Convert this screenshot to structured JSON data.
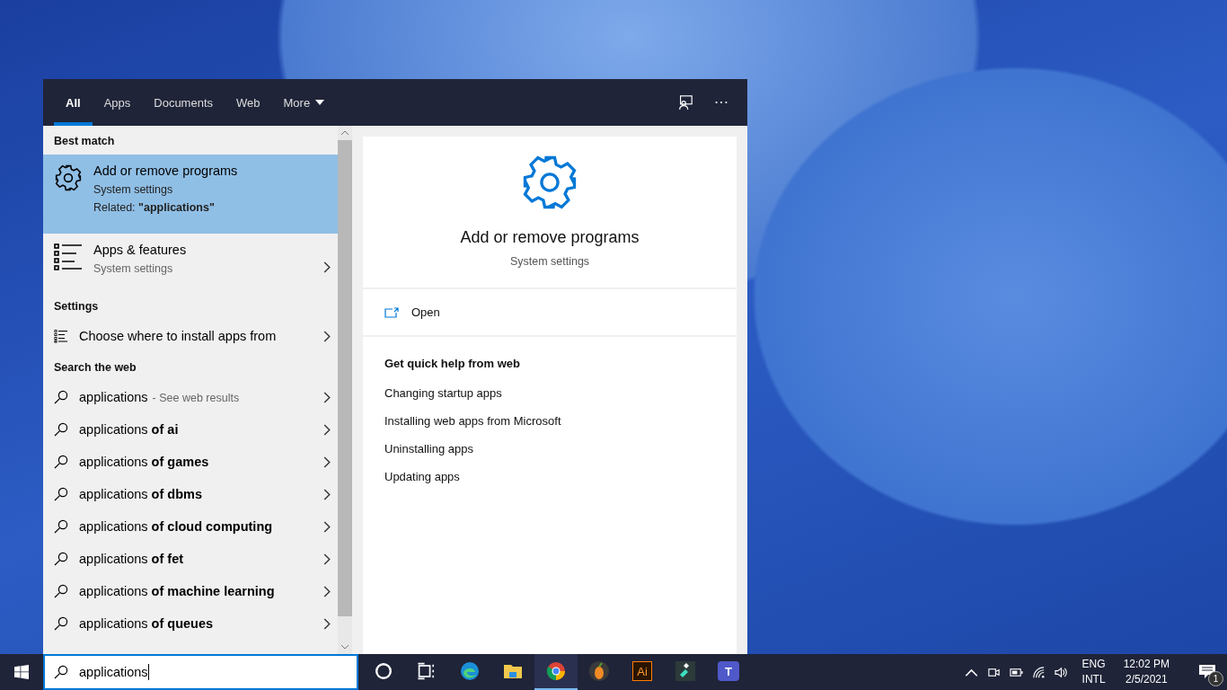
{
  "tabs": [
    {
      "label": "All",
      "selected": true,
      "menu": false
    },
    {
      "label": "Apps",
      "selected": false,
      "menu": false
    },
    {
      "label": "Documents",
      "selected": false,
      "menu": false
    },
    {
      "label": "Web",
      "selected": false,
      "menu": false
    },
    {
      "label": "More",
      "selected": false,
      "menu": true
    }
  ],
  "results": [
    {
      "kind": "heading",
      "label": "Best match"
    },
    {
      "kind": "best",
      "title": "Add or remove programs",
      "subtitle": "System settings",
      "related": "Related: **\"applications\"**",
      "selected": true
    },
    {
      "kind": "app",
      "title": "Apps & features",
      "subtitle": "System settings",
      "selected": false
    },
    {
      "kind": "heading",
      "label": "Settings"
    },
    {
      "kind": "setting",
      "title": "Choose where to install apps from",
      "selected": false
    },
    {
      "kind": "heading",
      "label": "Search the web"
    },
    {
      "kind": "web",
      "title": "applications",
      "hint": "- See web results",
      "selected": false
    },
    {
      "kind": "web",
      "title": "applications **of ai**",
      "selected": false
    },
    {
      "kind": "web",
      "title": "applications **of games**",
      "selected": false
    },
    {
      "kind": "web",
      "title": "applications **of dbms**",
      "selected": false
    },
    {
      "kind": "web",
      "title": "applications **of cloud computing**",
      "selected": false
    },
    {
      "kind": "web",
      "title": "applications **of fet**",
      "selected": false
    },
    {
      "kind": "web",
      "title": "applications **of machine learning**",
      "selected": false
    },
    {
      "kind": "web",
      "title": "applications **of queues**",
      "selected": false
    }
  ],
  "preview": {
    "title": "Add or remove programs",
    "subtitle": "System settings",
    "action": "Open",
    "help_heading": "Get quick help from web",
    "help_links": [
      "Changing startup apps",
      "Installing web apps from Microsoft",
      "Uninstalling apps",
      "Updating apps"
    ]
  },
  "search": {
    "value": "applications"
  },
  "taskbar_apps": [
    {
      "kind": "cortana",
      "running": false
    },
    {
      "kind": "taskview",
      "running": false
    },
    {
      "kind": "edge",
      "running": false
    },
    {
      "kind": "explorer",
      "running": false
    },
    {
      "kind": "chrome",
      "running": true
    },
    {
      "kind": "fruit",
      "running": false
    },
    {
      "kind": "illustrator",
      "label": "Ai",
      "running": false
    },
    {
      "kind": "filmora",
      "running": false
    },
    {
      "kind": "teams",
      "label": "T",
      "running": false
    }
  ],
  "tray": {
    "language": "ENG",
    "layout": "INTL",
    "time": "12:02 PM",
    "date": "2/5/2021",
    "notifications": "1"
  }
}
